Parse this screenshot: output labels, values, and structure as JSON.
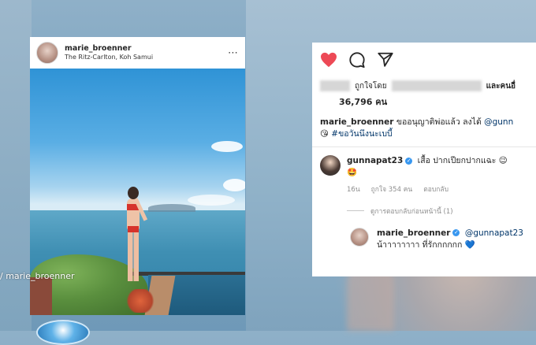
{
  "post": {
    "username": "marie_broenner",
    "location": "The Ritz-Carlton, Koh Samui",
    "more_icon": "⋯"
  },
  "watermark": "/ marie_broenner",
  "panel": {
    "icons": [
      "heart-icon",
      "comment-icon",
      "share-icon"
    ],
    "liked_by_prefix": "ถูกใจโดย",
    "liked_by_suffix": "และคนอื่",
    "likes_count": "36,796 คน",
    "caption_user": "marie_broenner",
    "caption_text": "ขออนุญาติพ่อแล้ว ลงได้",
    "caption_mention": "@gunn",
    "caption_line2_emoji": "😘",
    "caption_hashtag": "#ขอวันนึงนะเบบี้",
    "comment": {
      "user": "gunnapat23",
      "text": "เสื้อ ปากเปียกปากแฉะ",
      "emoji_end": "😉",
      "emoji_line2": "🤩",
      "time": "16น",
      "likes": "ถูกใจ 354 คน",
      "reply_label": "ตอบกลับ"
    },
    "view_replies": "ดูการตอบกลับก่อนหน้านี้ (1)",
    "reply": {
      "user": "marie_broenner",
      "mention": "@gunnapat23",
      "text": "น้าาาาาาาา ที่รักกกกกก",
      "emoji": "💙"
    }
  },
  "colors": {
    "heart": "#ed4956",
    "link": "#003569",
    "verified": "#3897f0"
  }
}
